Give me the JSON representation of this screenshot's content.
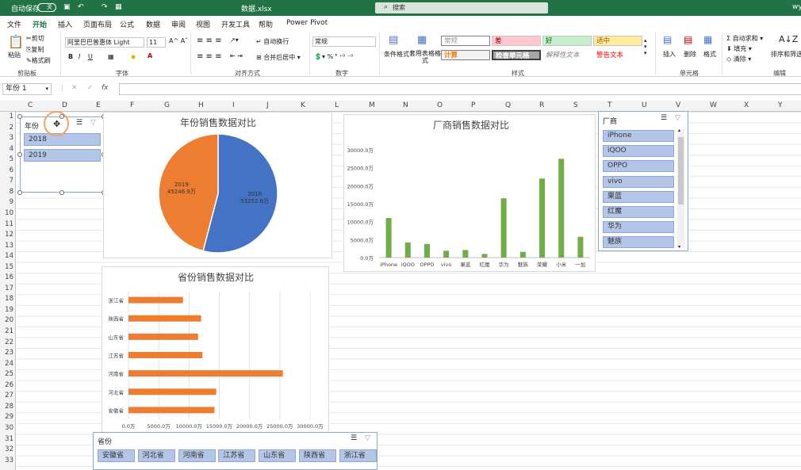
{
  "titlebar": {
    "autosave": "自动保存",
    "toggle": "关",
    "filename": "数据.xlsx",
    "search": "搜索",
    "user": "wy"
  },
  "menu": [
    "文件",
    "开始",
    "插入",
    "页面布局",
    "公式",
    "数据",
    "审阅",
    "视图",
    "开发工具",
    "帮助",
    "Power Pivot"
  ],
  "ribbon": {
    "clipboard": {
      "paste": "粘贴",
      "cut": "剪切",
      "copy": "复制",
      "format_painter": "格式刷",
      "group": "剪贴板"
    },
    "font": {
      "name": "阿里巴巴普惠体 Light",
      "size": "11",
      "group": "字体"
    },
    "align": {
      "wrap": "自动换行",
      "merge": "合并后居中",
      "group": "对齐方式"
    },
    "number": {
      "format": "常规",
      "group": "数字"
    },
    "styles": {
      "cond": "条件格式",
      "table": "套用表格格式",
      "normal": "常规",
      "bad": "差",
      "good": "好",
      "neutral": "适中",
      "calc": "计算",
      "check": "检查单元格",
      "explain": "解释性文本",
      "warn": "警告文本",
      "group": "样式"
    },
    "cells": {
      "insert": "插入",
      "delete": "删除",
      "format": "格式",
      "group": "单元格"
    },
    "editing": {
      "autosum": "自动求和",
      "fill": "填充",
      "clear": "清除",
      "sort": "排序和筛选",
      "group": "编辑"
    }
  },
  "namebox": "年份 1",
  "columns": [
    "C",
    "D",
    "E",
    "F",
    "G",
    "H",
    "I",
    "J",
    "K",
    "L",
    "M",
    "N",
    "O",
    "P",
    "Q",
    "R",
    "S",
    "T",
    "U",
    "V",
    "W",
    "X",
    "Y"
  ],
  "rows": [
    "1",
    "2",
    "3",
    "4",
    "5",
    "6",
    "7",
    "8",
    "9",
    "10",
    "11",
    "12",
    "13",
    "14",
    "15",
    "16",
    "17",
    "18",
    "19",
    "20",
    "21",
    "22",
    "23",
    "24",
    "25",
    "26",
    "27",
    "28",
    "29",
    "30",
    "31",
    "32",
    "33"
  ],
  "slicer_year": {
    "title": "年份",
    "items": [
      "2018",
      "2019"
    ]
  },
  "slicer_vendor": {
    "title": "厂商",
    "items": [
      "iPhone",
      "iQOO",
      "OPPO",
      "vivo",
      "果蓝",
      "红魔",
      "华为",
      "魅族"
    ]
  },
  "slicer_province": {
    "title": "省份",
    "items": [
      "安徽省",
      "河北省",
      "河南省",
      "江苏省",
      "山东省",
      "陕西省",
      "浙江省"
    ]
  },
  "chart_data": [
    {
      "type": "pie",
      "title": "年份销售数据对比",
      "categories": [
        "2018",
        "2019"
      ],
      "values": [
        53252.6,
        45246.9
      ],
      "labels": [
        "2018\n53252.6万",
        "2019\n45246.9万"
      ],
      "colors": [
        "#4472c4",
        "#ed7d31"
      ]
    },
    {
      "type": "bar",
      "title": "厂商销售数据对比",
      "categories": [
        "iPhone",
        "iQOO",
        "OPPO",
        "vivo",
        "果蓝",
        "红魔",
        "华为",
        "魅族",
        "荣耀",
        "小米",
        "一加"
      ],
      "values": [
        11000,
        4200,
        3800,
        1900,
        2100,
        1000,
        16500,
        1600,
        22000,
        27500,
        5800
      ],
      "ylim": [
        0,
        30000
      ],
      "yticks": [
        "0.0万",
        "5000.0万",
        "10000.0万",
        "15000.0万",
        "20000.0万",
        "25000.0万",
        "30000.0万"
      ],
      "color": "#70ad47"
    },
    {
      "type": "bar",
      "orientation": "horizontal",
      "title": "省份销售数据对比",
      "categories": [
        "浙江省",
        "陕西省",
        "山东省",
        "江苏省",
        "河南省",
        "河北省",
        "安徽省"
      ],
      "values": [
        9000,
        12000,
        11500,
        12200,
        25500,
        14500,
        14200
      ],
      "xlim": [
        0,
        30000
      ],
      "xticks": [
        "0.0万",
        "5000.0万",
        "10000.0万",
        "15000.0万",
        "20000.0万",
        "25000.0万",
        "30000.0万"
      ],
      "color": "#ed7d31"
    }
  ]
}
